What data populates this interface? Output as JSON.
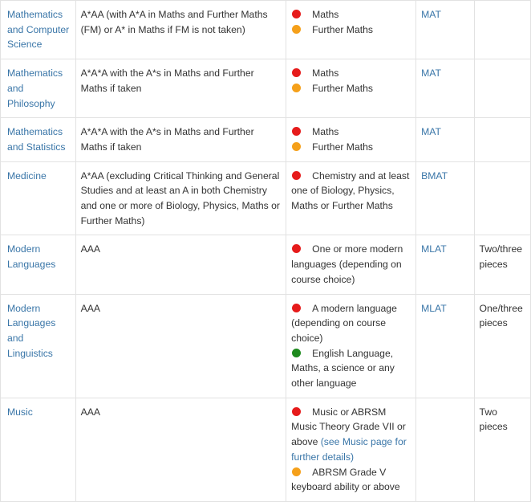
{
  "colors": {
    "required": "#e61b1b",
    "recommended": "#f5a01a",
    "helpful": "#1e8a1e",
    "link": "#3a76a8"
  },
  "rows": [
    {
      "course": "Mathematics and Computer Science",
      "grades": "A*AA (with A*A in Maths and Further Maths (FM) or A* in Maths if FM is not taken)",
      "subjects": [
        {
          "level": "required",
          "text": "Maths"
        },
        {
          "level": "recommended",
          "text": "Further Maths"
        }
      ],
      "test": "MAT",
      "written_work": ""
    },
    {
      "course": "Mathematics and Philosophy",
      "grades": "A*A*A with the A*s in Maths and Further Maths if taken",
      "subjects": [
        {
          "level": "required",
          "text": "Maths"
        },
        {
          "level": "recommended",
          "text": "Further Maths"
        }
      ],
      "test": "MAT",
      "written_work": ""
    },
    {
      "course": "Mathematics and Statistics",
      "grades": "A*A*A with the A*s in Maths and Further Maths if taken",
      "subjects": [
        {
          "level": "required",
          "text": "Maths"
        },
        {
          "level": "recommended",
          "text": "Further Maths"
        }
      ],
      "test": "MAT",
      "written_work": ""
    },
    {
      "course": "Medicine",
      "grades": "A*AA (excluding Critical Thinking and General Studies and at least an A in both Chemistry and one or more of Biology, Physics, Maths or Further Maths)",
      "subjects": [
        {
          "level": "required",
          "text": "Chemistry and at least one of Biology, Physics, Maths or Further Maths"
        }
      ],
      "test": "BMAT",
      "written_work": ""
    },
    {
      "course": "Modern Languages",
      "grades": "AAA",
      "subjects": [
        {
          "level": "required",
          "text": "One or more modern languages (depending on course choice)"
        }
      ],
      "test": "MLAT",
      "written_work": "Two/three pieces"
    },
    {
      "course": "Modern Languages and Linguistics",
      "grades": "AAA",
      "subjects": [
        {
          "level": "required",
          "text": "A modern language (depending on course choice)"
        },
        {
          "level": "helpful",
          "text": "English Language, Maths, a science or any other language"
        }
      ],
      "test": "MLAT",
      "written_work": "One/three pieces"
    },
    {
      "course": "Music",
      "grades": "AAA",
      "subjects": [
        {
          "level": "required",
          "text": "Music or ABRSM Music Theory Grade VII or above",
          "link_text": "(see Music page for further details)"
        },
        {
          "level": "recommended",
          "text": "ABRSM Grade V keyboard ability or above"
        }
      ],
      "test": "",
      "written_work": "Two pieces"
    }
  ]
}
